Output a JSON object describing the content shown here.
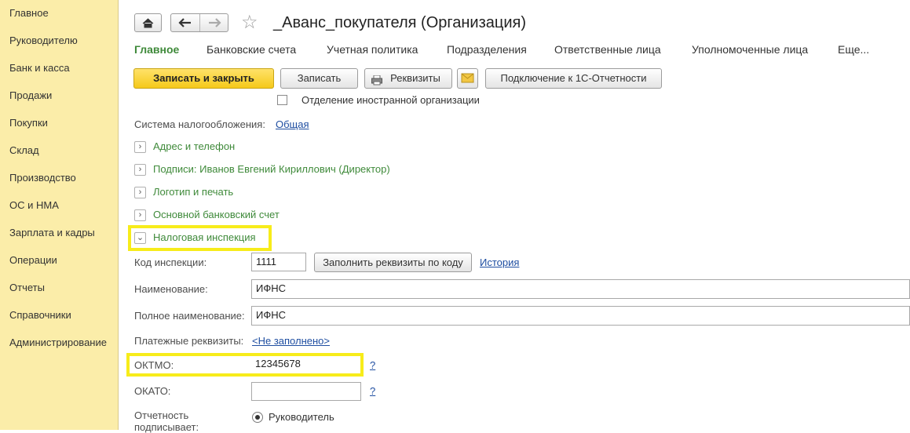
{
  "sidebar": {
    "items": [
      {
        "label": "Главное"
      },
      {
        "label": "Руководителю"
      },
      {
        "label": "Банк и касса"
      },
      {
        "label": "Продажи"
      },
      {
        "label": "Покупки"
      },
      {
        "label": "Склад"
      },
      {
        "label": "Производство"
      },
      {
        "label": "ОС и НМА"
      },
      {
        "label": "Зарплата и кадры"
      },
      {
        "label": "Операции"
      },
      {
        "label": "Отчеты"
      },
      {
        "label": "Справочники"
      },
      {
        "label": "Администрирование"
      }
    ]
  },
  "header": {
    "home_icon": "home-icon",
    "back_icon": "arrow-left-icon",
    "forward_icon": "arrow-right-icon",
    "favorite_icon": "star-icon",
    "title": "_Аванс_покупателя (Организация)"
  },
  "tabs": [
    {
      "label": "Главное",
      "active": true
    },
    {
      "label": "Банковские счета"
    },
    {
      "label": "Учетная политика"
    },
    {
      "label": "Подразделения"
    },
    {
      "label": "Ответственные лица"
    },
    {
      "label": "Уполномоченные лица"
    },
    {
      "label": "Еще..."
    }
  ],
  "toolbar": {
    "save_close": "Записать и закрыть",
    "save": "Записать",
    "requisites": "Реквизиты",
    "mail_icon": "envelope-icon",
    "printer_icon": "printer-icon",
    "connect": "Подключение к 1С-Отчетности"
  },
  "foreign_branch": {
    "label": "Отделение иностранной организации",
    "checked": false
  },
  "tax_system": {
    "label": "Система налогообложения:",
    "value": "Общая"
  },
  "groups": [
    {
      "label": "Адрес и телефон",
      "expanded": false
    },
    {
      "label": "Подписи: Иванов Евгений Кириллович (Директор)",
      "expanded": false
    },
    {
      "label": "Логотип и печать",
      "expanded": false
    },
    {
      "label": "Основной банковский счет",
      "expanded": false
    },
    {
      "label": "Налоговая инспекция",
      "expanded": true
    }
  ],
  "inspection": {
    "code_label": "Код инспекции:",
    "code_value": "1111",
    "fill_button": "Заполнить реквизиты по коду",
    "history_link": "История",
    "name_label": "Наименование:",
    "name_value": "ИФНС",
    "full_name_label": "Полное наименование:",
    "full_name_value": "ИФНС",
    "payment_label": "Платежные реквизиты:",
    "payment_link": "<Не заполнено>",
    "oktmo_label": "ОКТМО:",
    "oktmo_value": "12345678",
    "okato_label": "ОКАТО:",
    "okato_value": "",
    "help_mark": "?",
    "signer_label": "Отчетность подписывает:",
    "signer_option": "Руководитель"
  },
  "colors": {
    "sidebar_bg": "#fbeda9",
    "accent_green": "#3f8a3a",
    "link_blue": "#1f4ea1",
    "primary_button": "#f5c91a",
    "highlight": "#f7ec1a"
  }
}
